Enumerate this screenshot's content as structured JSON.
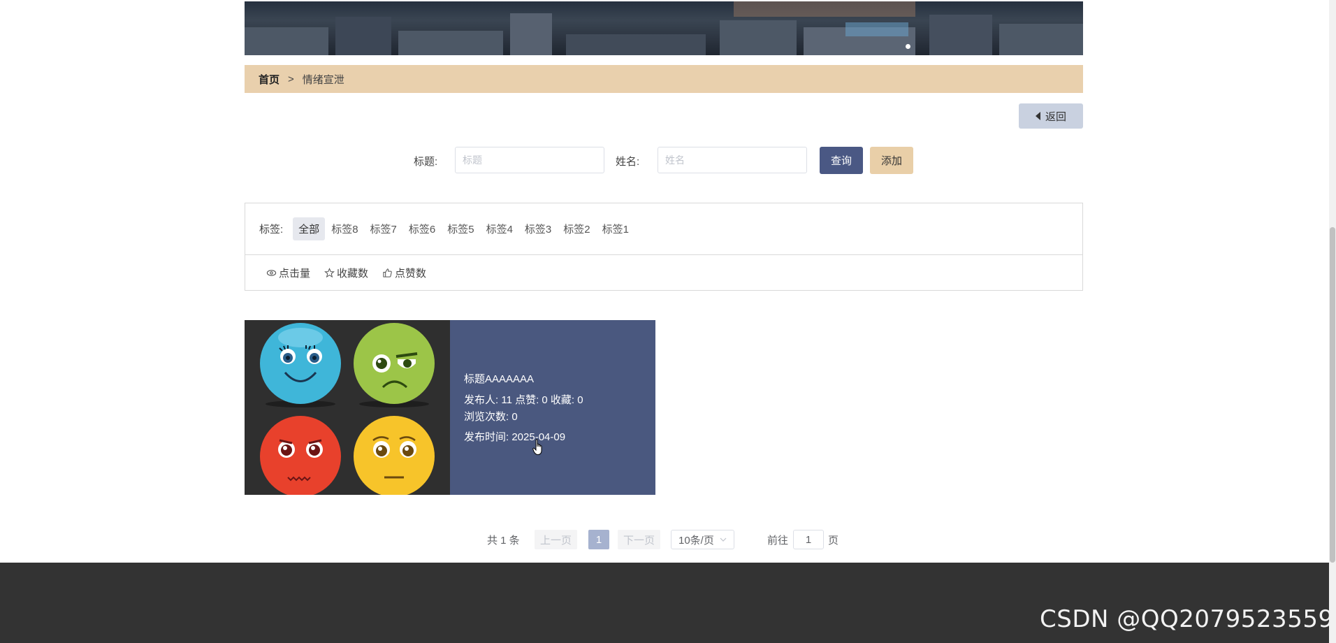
{
  "breadcrumb": {
    "home": "首页",
    "separator": ">",
    "current": "情绪宣泄"
  },
  "back_button": {
    "label": "返回",
    "icon": "caret-left-icon"
  },
  "search": {
    "title_label": "标题:",
    "title_placeholder": "标题",
    "name_label": "姓名:",
    "name_placeholder": "姓名",
    "query_label": "查询",
    "add_label": "添加"
  },
  "tags": {
    "label": "标签:",
    "items": [
      "全部",
      "标签8",
      "标签7",
      "标签6",
      "标签5",
      "标签4",
      "标签3",
      "标签2",
      "标签1"
    ],
    "active": "全部"
  },
  "sort": [
    {
      "label": "点击量",
      "icon": "eye-icon"
    },
    {
      "label": "收藏数",
      "icon": "star-icon"
    },
    {
      "label": "点赞数",
      "icon": "thumbs-up-icon"
    }
  ],
  "card": {
    "title": "标题AAAAAAA",
    "publisher_line": "发布人:  11  点赞:  0  收藏:  0",
    "views_line": "浏览次数:  0",
    "time_line": "发布时间:  2025-04-09"
  },
  "pagination": {
    "total": "共 1 条",
    "prev": "上一页",
    "current_page": "1",
    "next": "下一页",
    "page_size": "10条/页",
    "goto_label": "前往",
    "goto_value": "1",
    "page_unit": "页"
  },
  "watermark": "CSDN @QQ2079523559",
  "colors": {
    "breadcrumb_bg": "#e9d0ad",
    "query_button": "#4a5884",
    "add_button": "#e9cfa8",
    "card_info_bg": "#4a587f",
    "footer_bg": "#333333"
  }
}
